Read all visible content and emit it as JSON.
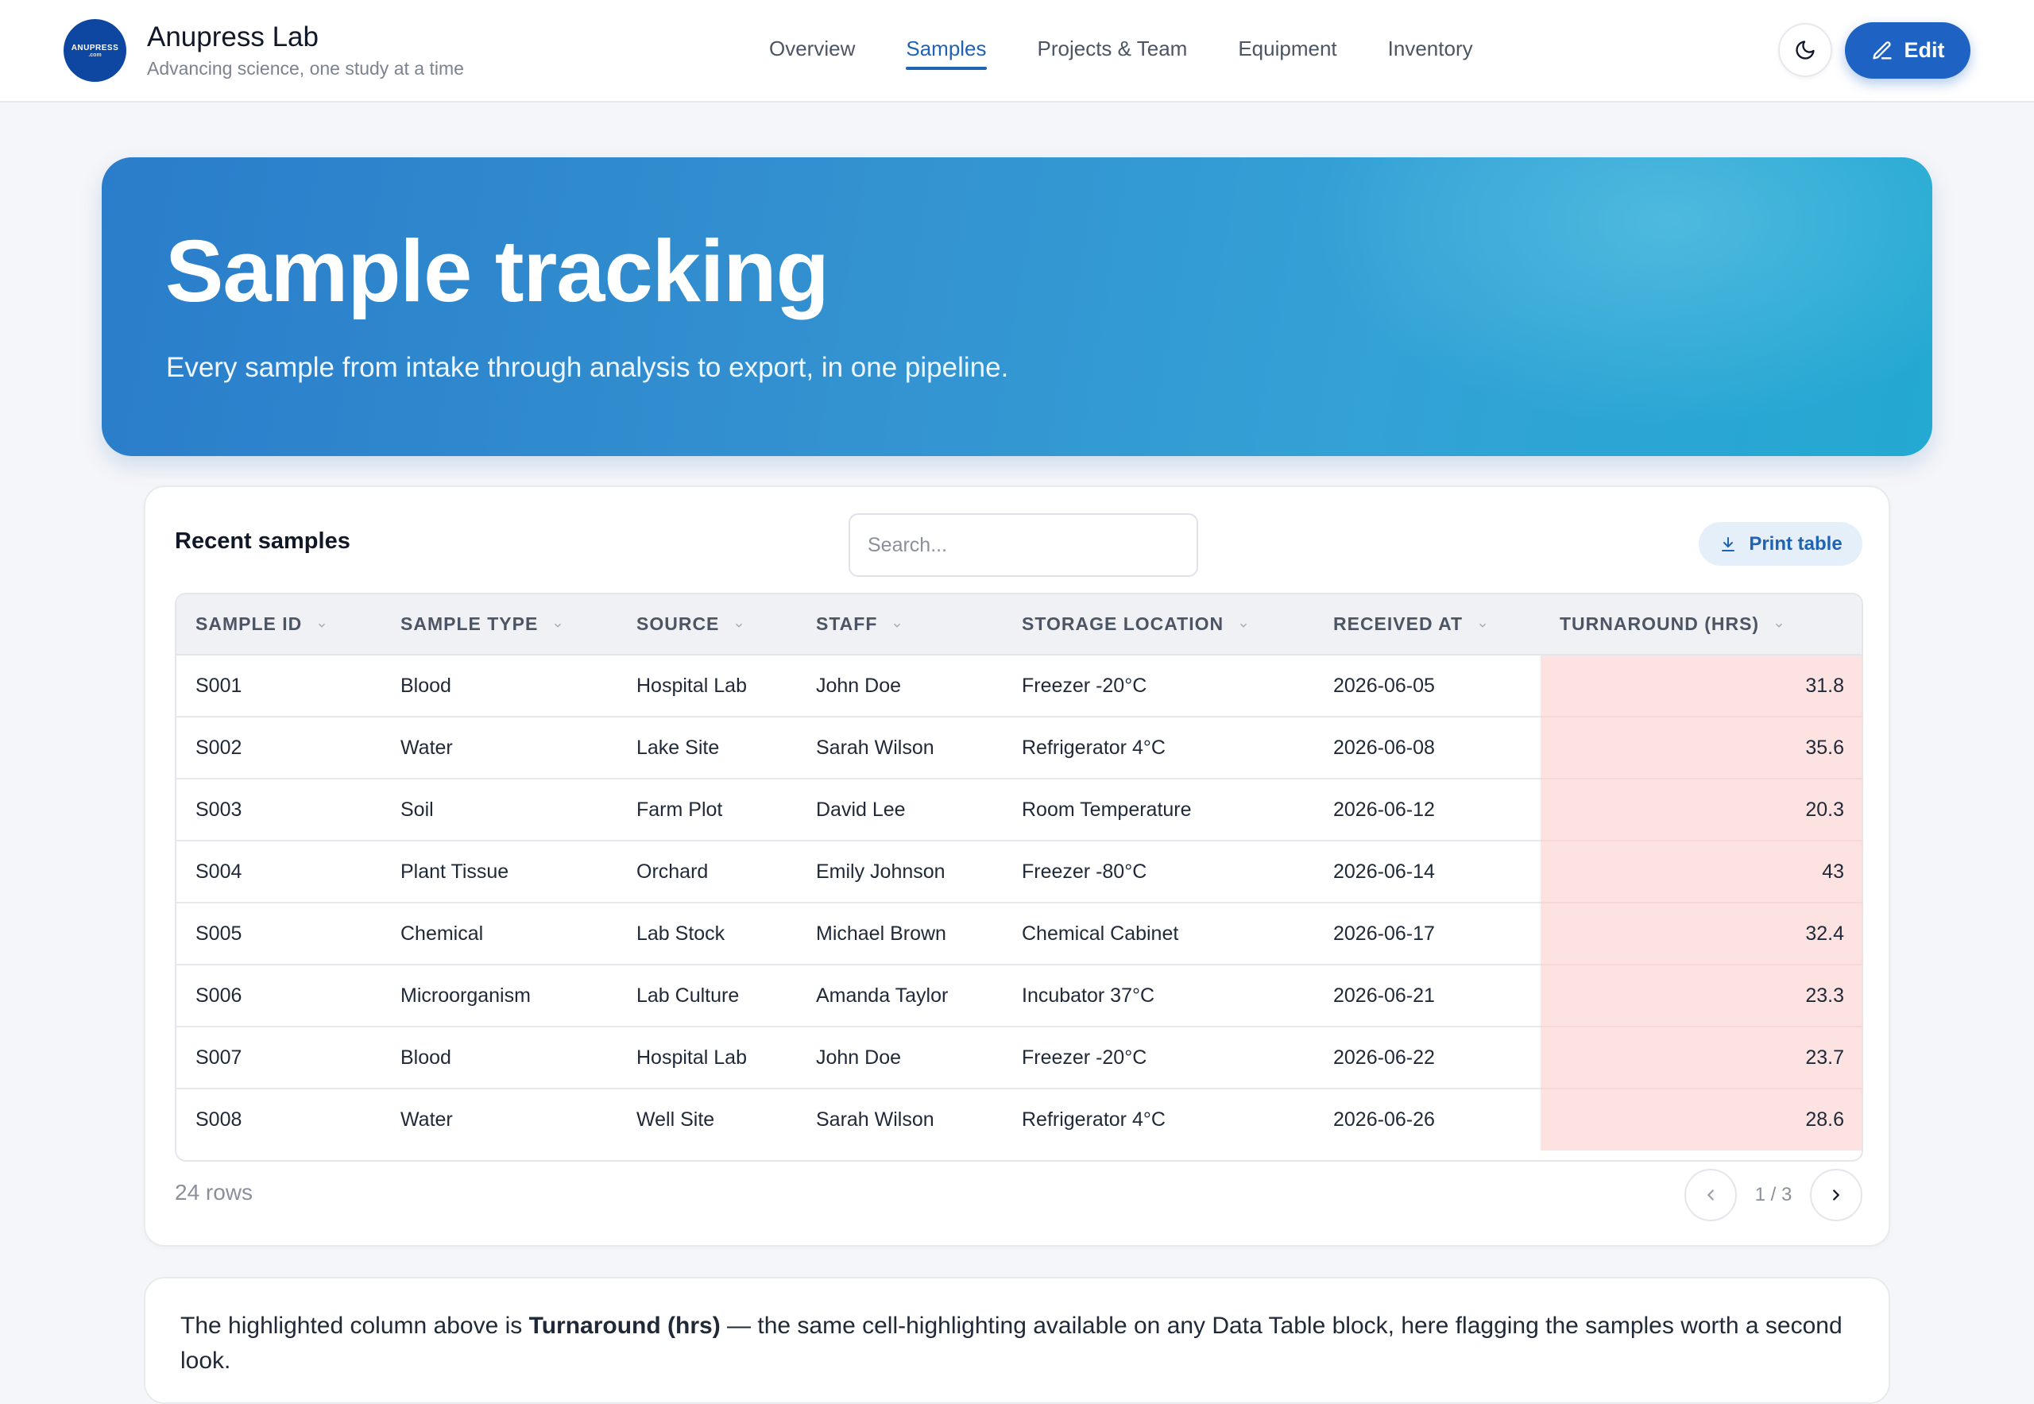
{
  "brand": {
    "logo_text": "ANUPRESS",
    "logo_sub": ".com",
    "name": "Anupress Lab",
    "tagline": "Advancing science, one study at a time"
  },
  "nav": {
    "items": [
      {
        "label": "Overview",
        "active": false
      },
      {
        "label": "Samples",
        "active": true
      },
      {
        "label": "Projects & Team",
        "active": false
      },
      {
        "label": "Equipment",
        "active": false
      },
      {
        "label": "Inventory",
        "active": false
      }
    ]
  },
  "header_actions": {
    "theme_icon": "moon-icon",
    "edit_label": "Edit",
    "edit_icon": "pencil-icon"
  },
  "hero": {
    "title": "Sample tracking",
    "subtitle": "Every sample from intake through analysis to export, in one pipeline."
  },
  "table_card": {
    "title": "Recent samples",
    "search_placeholder": "Search...",
    "print_label": "Print table",
    "print_icon": "download-icon",
    "columns": [
      "SAMPLE ID",
      "SAMPLE TYPE",
      "SOURCE",
      "STAFF",
      "STORAGE LOCATION",
      "RECEIVED AT",
      "TURNAROUND (HRS)"
    ],
    "rows": [
      [
        "S001",
        "Blood",
        "Hospital Lab",
        "John Doe",
        "Freezer -20°C",
        "2026-06-05",
        "31.8"
      ],
      [
        "S002",
        "Water",
        "Lake Site",
        "Sarah Wilson",
        "Refrigerator 4°C",
        "2026-06-08",
        "35.6"
      ],
      [
        "S003",
        "Soil",
        "Farm Plot",
        "David Lee",
        "Room Temperature",
        "2026-06-12",
        "20.3"
      ],
      [
        "S004",
        "Plant Tissue",
        "Orchard",
        "Emily Johnson",
        "Freezer -80°C",
        "2026-06-14",
        "43"
      ],
      [
        "S005",
        "Chemical",
        "Lab Stock",
        "Michael Brown",
        "Chemical Cabinet",
        "2026-06-17",
        "32.4"
      ],
      [
        "S006",
        "Microorganism",
        "Lab Culture",
        "Amanda Taylor",
        "Incubator 37°C",
        "2026-06-21",
        "23.3"
      ],
      [
        "S007",
        "Blood",
        "Hospital Lab",
        "John Doe",
        "Freezer -20°C",
        "2026-06-22",
        "23.7"
      ],
      [
        "S008",
        "Water",
        "Well Site",
        "Sarah Wilson",
        "Refrigerator 4°C",
        "2026-06-26",
        "28.6"
      ]
    ],
    "row_count": "24 rows",
    "page_label": "1 / 3"
  },
  "note": {
    "prefix": "The highlighted column above is ",
    "highlight": "Turnaround (hrs)",
    "suffix": " — the same cell-highlighting available on any Data Table block, here flagging the samples worth a second look."
  },
  "colors": {
    "accent": "#1e63c4",
    "highlight_cell": "#fde2e2",
    "hero_start": "#2a7dca",
    "hero_end": "#23a9d2"
  }
}
